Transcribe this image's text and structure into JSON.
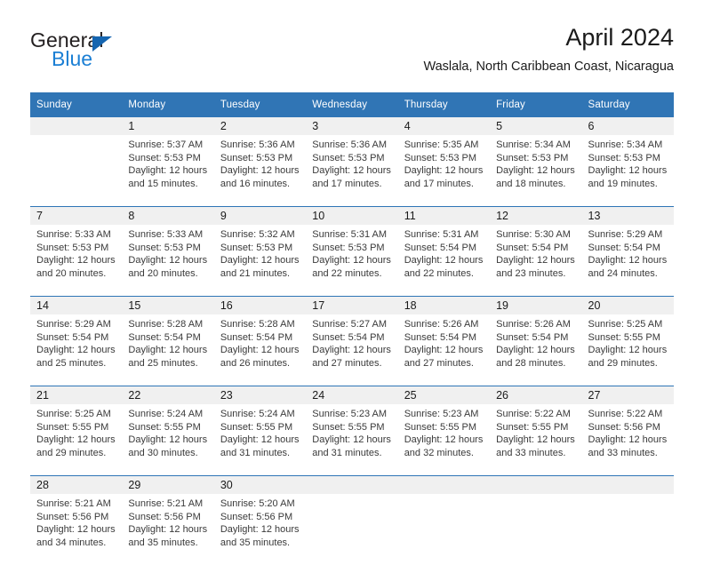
{
  "brand": {
    "name_top": "General",
    "name_bottom": "Blue",
    "mark": "triangle-logo"
  },
  "header": {
    "title": "April 2024",
    "subtitle": "Waslala, North Caribbean Coast, Nicaragua"
  },
  "colors": {
    "header_blue": "#3075b5",
    "separator_blue": "#2e75b6",
    "daynum_band": "#f0f0f0",
    "brand_blue": "#1b7fd4"
  },
  "calendar": {
    "weekdays": [
      "Sunday",
      "Monday",
      "Tuesday",
      "Wednesday",
      "Thursday",
      "Friday",
      "Saturday"
    ],
    "weeks": [
      [
        {
          "day": "",
          "lines": []
        },
        {
          "day": "1",
          "lines": [
            "Sunrise: 5:37 AM",
            "Sunset: 5:53 PM",
            "Daylight: 12 hours",
            "and 15 minutes."
          ]
        },
        {
          "day": "2",
          "lines": [
            "Sunrise: 5:36 AM",
            "Sunset: 5:53 PM",
            "Daylight: 12 hours",
            "and 16 minutes."
          ]
        },
        {
          "day": "3",
          "lines": [
            "Sunrise: 5:36 AM",
            "Sunset: 5:53 PM",
            "Daylight: 12 hours",
            "and 17 minutes."
          ]
        },
        {
          "day": "4",
          "lines": [
            "Sunrise: 5:35 AM",
            "Sunset: 5:53 PM",
            "Daylight: 12 hours",
            "and 17 minutes."
          ]
        },
        {
          "day": "5",
          "lines": [
            "Sunrise: 5:34 AM",
            "Sunset: 5:53 PM",
            "Daylight: 12 hours",
            "and 18 minutes."
          ]
        },
        {
          "day": "6",
          "lines": [
            "Sunrise: 5:34 AM",
            "Sunset: 5:53 PM",
            "Daylight: 12 hours",
            "and 19 minutes."
          ]
        }
      ],
      [
        {
          "day": "7",
          "lines": [
            "Sunrise: 5:33 AM",
            "Sunset: 5:53 PM",
            "Daylight: 12 hours",
            "and 20 minutes."
          ]
        },
        {
          "day": "8",
          "lines": [
            "Sunrise: 5:33 AM",
            "Sunset: 5:53 PM",
            "Daylight: 12 hours",
            "and 20 minutes."
          ]
        },
        {
          "day": "9",
          "lines": [
            "Sunrise: 5:32 AM",
            "Sunset: 5:53 PM",
            "Daylight: 12 hours",
            "and 21 minutes."
          ]
        },
        {
          "day": "10",
          "lines": [
            "Sunrise: 5:31 AM",
            "Sunset: 5:53 PM",
            "Daylight: 12 hours",
            "and 22 minutes."
          ]
        },
        {
          "day": "11",
          "lines": [
            "Sunrise: 5:31 AM",
            "Sunset: 5:54 PM",
            "Daylight: 12 hours",
            "and 22 minutes."
          ]
        },
        {
          "day": "12",
          "lines": [
            "Sunrise: 5:30 AM",
            "Sunset: 5:54 PM",
            "Daylight: 12 hours",
            "and 23 minutes."
          ]
        },
        {
          "day": "13",
          "lines": [
            "Sunrise: 5:29 AM",
            "Sunset: 5:54 PM",
            "Daylight: 12 hours",
            "and 24 minutes."
          ]
        }
      ],
      [
        {
          "day": "14",
          "lines": [
            "Sunrise: 5:29 AM",
            "Sunset: 5:54 PM",
            "Daylight: 12 hours",
            "and 25 minutes."
          ]
        },
        {
          "day": "15",
          "lines": [
            "Sunrise: 5:28 AM",
            "Sunset: 5:54 PM",
            "Daylight: 12 hours",
            "and 25 minutes."
          ]
        },
        {
          "day": "16",
          "lines": [
            "Sunrise: 5:28 AM",
            "Sunset: 5:54 PM",
            "Daylight: 12 hours",
            "and 26 minutes."
          ]
        },
        {
          "day": "17",
          "lines": [
            "Sunrise: 5:27 AM",
            "Sunset: 5:54 PM",
            "Daylight: 12 hours",
            "and 27 minutes."
          ]
        },
        {
          "day": "18",
          "lines": [
            "Sunrise: 5:26 AM",
            "Sunset: 5:54 PM",
            "Daylight: 12 hours",
            "and 27 minutes."
          ]
        },
        {
          "day": "19",
          "lines": [
            "Sunrise: 5:26 AM",
            "Sunset: 5:54 PM",
            "Daylight: 12 hours",
            "and 28 minutes."
          ]
        },
        {
          "day": "20",
          "lines": [
            "Sunrise: 5:25 AM",
            "Sunset: 5:55 PM",
            "Daylight: 12 hours",
            "and 29 minutes."
          ]
        }
      ],
      [
        {
          "day": "21",
          "lines": [
            "Sunrise: 5:25 AM",
            "Sunset: 5:55 PM",
            "Daylight: 12 hours",
            "and 29 minutes."
          ]
        },
        {
          "day": "22",
          "lines": [
            "Sunrise: 5:24 AM",
            "Sunset: 5:55 PM",
            "Daylight: 12 hours",
            "and 30 minutes."
          ]
        },
        {
          "day": "23",
          "lines": [
            "Sunrise: 5:24 AM",
            "Sunset: 5:55 PM",
            "Daylight: 12 hours",
            "and 31 minutes."
          ]
        },
        {
          "day": "24",
          "lines": [
            "Sunrise: 5:23 AM",
            "Sunset: 5:55 PM",
            "Daylight: 12 hours",
            "and 31 minutes."
          ]
        },
        {
          "day": "25",
          "lines": [
            "Sunrise: 5:23 AM",
            "Sunset: 5:55 PM",
            "Daylight: 12 hours",
            "and 32 minutes."
          ]
        },
        {
          "day": "26",
          "lines": [
            "Sunrise: 5:22 AM",
            "Sunset: 5:55 PM",
            "Daylight: 12 hours",
            "and 33 minutes."
          ]
        },
        {
          "day": "27",
          "lines": [
            "Sunrise: 5:22 AM",
            "Sunset: 5:56 PM",
            "Daylight: 12 hours",
            "and 33 minutes."
          ]
        }
      ],
      [
        {
          "day": "28",
          "lines": [
            "Sunrise: 5:21 AM",
            "Sunset: 5:56 PM",
            "Daylight: 12 hours",
            "and 34 minutes."
          ]
        },
        {
          "day": "29",
          "lines": [
            "Sunrise: 5:21 AM",
            "Sunset: 5:56 PM",
            "Daylight: 12 hours",
            "and 35 minutes."
          ]
        },
        {
          "day": "30",
          "lines": [
            "Sunrise: 5:20 AM",
            "Sunset: 5:56 PM",
            "Daylight: 12 hours",
            "and 35 minutes."
          ]
        },
        {
          "day": "",
          "lines": []
        },
        {
          "day": "",
          "lines": []
        },
        {
          "day": "",
          "lines": []
        },
        {
          "day": "",
          "lines": []
        }
      ]
    ]
  }
}
